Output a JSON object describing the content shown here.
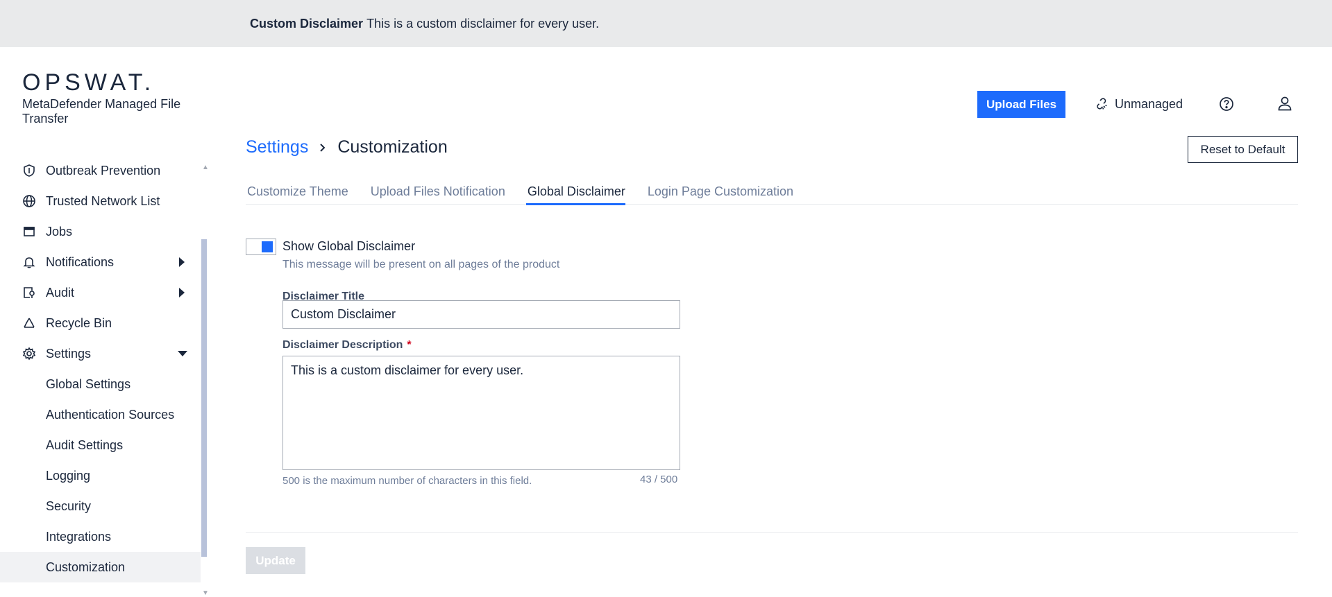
{
  "disclaimer_bar": {
    "title": "Custom Disclaimer",
    "text": "This is a custom disclaimer for every user."
  },
  "brand": {
    "logo": "OPSWAT.",
    "product": "MetaDefender Managed File Transfer"
  },
  "sidebar": {
    "items": [
      {
        "label": "Outbreak Prevention",
        "icon": "shield-icon"
      },
      {
        "label": "Trusted Network List",
        "icon": "globe-icon"
      },
      {
        "label": "Jobs",
        "icon": "window-icon"
      },
      {
        "label": "Notifications",
        "icon": "bell-icon"
      },
      {
        "label": "Audit",
        "icon": "audit-icon"
      },
      {
        "label": "Recycle Bin",
        "icon": "recycle-icon"
      },
      {
        "label": "Settings",
        "icon": "gear-icon"
      }
    ],
    "sub_items": [
      {
        "label": "Global Settings"
      },
      {
        "label": "Authentication Sources"
      },
      {
        "label": "Audit Settings"
      },
      {
        "label": "Logging"
      },
      {
        "label": "Security"
      },
      {
        "label": "Integrations"
      },
      {
        "label": "Customization"
      }
    ]
  },
  "header": {
    "upload_label": "Upload Files",
    "unmanaged_label": "Unmanaged"
  },
  "breadcrumb": {
    "parent": "Settings",
    "current": "Customization"
  },
  "reset_label": "Reset to Default",
  "tabs": [
    {
      "label": "Customize Theme"
    },
    {
      "label": "Upload Files Notification"
    },
    {
      "label": "Global Disclaimer"
    },
    {
      "label": "Login Page Customization"
    }
  ],
  "form": {
    "toggle_label": "Show Global Disclaimer",
    "toggle_help": "This message will be present on all pages of the product",
    "toggle_on": true,
    "title_label": "Disclaimer Title",
    "title_value": "Custom Disclaimer",
    "description_label": "Disclaimer Description",
    "required_mark": "*",
    "description_value": "This is a custom disclaimer for every user.",
    "max_help": "500 is the maximum number of characters in this field.",
    "char_count": "43 / 500",
    "update_label": "Update"
  },
  "colors": {
    "accent": "#1d6bfc",
    "text": "#1b273c",
    "muted": "#6e7d99",
    "disclaimer_bg": "#e9eaeb"
  }
}
